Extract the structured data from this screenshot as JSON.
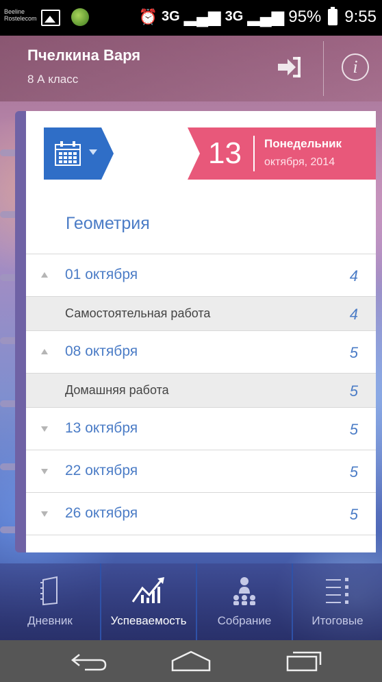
{
  "statusbar": {
    "carrier1": "Beeline",
    "carrier2": "Rostelecom",
    "alarm_icon": "alarm-icon",
    "net1": "3G",
    "net2": "3G",
    "battery": "95%",
    "time": "9:55"
  },
  "header": {
    "student_name": "Пчелкина Варя",
    "student_class": "8 А класс",
    "logout_icon": "logout-icon",
    "info_icon": "info-icon"
  },
  "date": {
    "day": "13",
    "weekday": "Понедельник",
    "month_year": "октября, 2014",
    "calendar_icon": "calendar-icon"
  },
  "subject": "Геометрия",
  "grades": [
    {
      "type": "date",
      "expanded": true,
      "label": "01 октября",
      "mark": "4"
    },
    {
      "type": "work",
      "label": "Самостоятельная работа",
      "mark": "4"
    },
    {
      "type": "date",
      "expanded": true,
      "label": "08 октября",
      "mark": "5"
    },
    {
      "type": "work",
      "label": "Домашняя работа",
      "mark": "5"
    },
    {
      "type": "date",
      "expanded": false,
      "label": "13 октября",
      "mark": "5"
    },
    {
      "type": "date",
      "expanded": false,
      "label": "22 октября",
      "mark": "5"
    },
    {
      "type": "date",
      "expanded": false,
      "label": "26 октября",
      "mark": "5"
    }
  ],
  "tabs": [
    {
      "label": "Дневник",
      "icon": "diary-icon"
    },
    {
      "label": "Успеваемость",
      "icon": "chart-icon",
      "active": true
    },
    {
      "label": "Собрание",
      "icon": "meeting-icon"
    },
    {
      "label": "Итоговые",
      "icon": "list-icon"
    }
  ],
  "colors": {
    "accent_blue": "#2f6ec7",
    "date_pink": "#e8587a",
    "text_blue": "#4b7cc6"
  }
}
